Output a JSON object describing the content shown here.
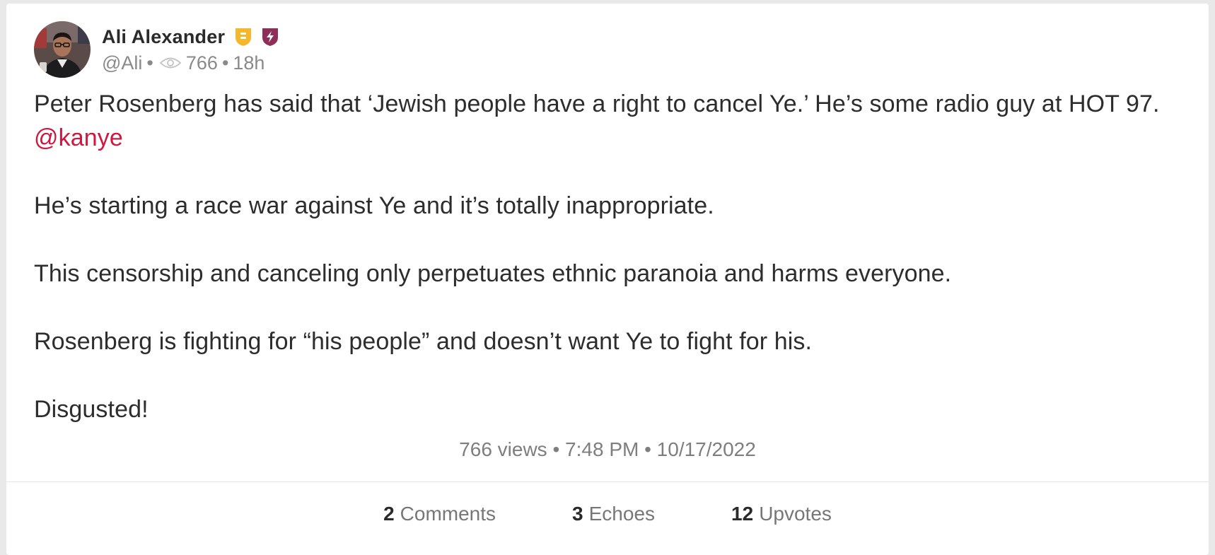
{
  "post": {
    "author": {
      "name": "Ali Alexander",
      "handle": "@Ali",
      "badges": [
        "gold-shield-icon",
        "purple-bolt-shield-icon"
      ]
    },
    "meta": {
      "views": "766",
      "age": "18h"
    },
    "body": {
      "p1_text": "Peter Rosenberg has said that ‘Jewish people have a right to cancel Ye.’ He’s some radio guy at HOT 97. ",
      "p1_mention": "@kanye",
      "p2": "He’s starting a race war against Ye and it’s totally inappropriate.",
      "p3": "This censorship and canceling only perpetuates ethnic paranoia and harms everyone.",
      "p4": "Rosenberg is fighting for “his people” and doesn’t want Ye to fight for his.",
      "p5": "Disgusted!"
    },
    "footer_meta": "766 views • 7:48 PM • 10/17/2022",
    "actions": {
      "comments": {
        "count": "2",
        "label": "Comments"
      },
      "echoes": {
        "count": "3",
        "label": "Echoes"
      },
      "upvotes": {
        "count": "12",
        "label": "Upvotes"
      }
    }
  },
  "colors": {
    "mention": "#d0183f",
    "badge_gold": "#f5b72c",
    "badge_purple": "#8e2f5a"
  }
}
